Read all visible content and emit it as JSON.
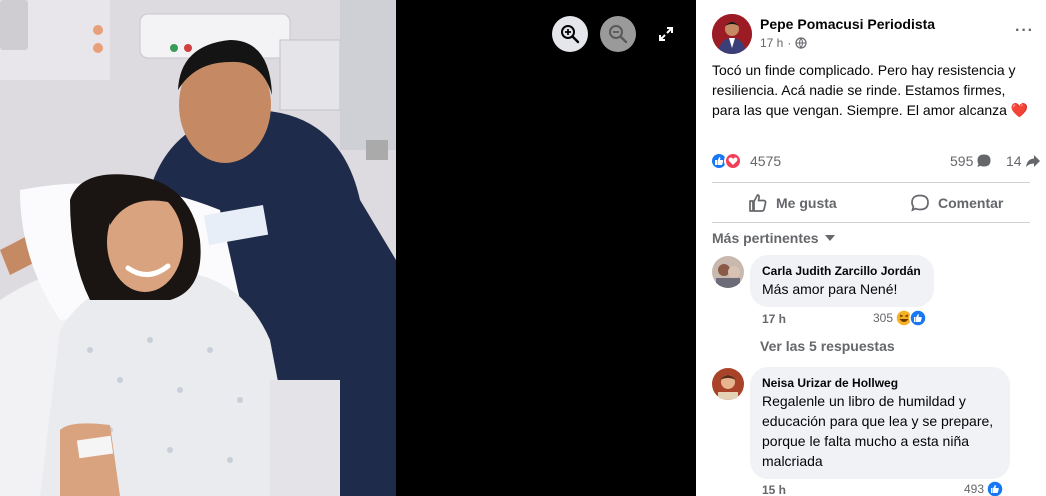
{
  "post": {
    "author": "Pepe Pomacusi Periodista",
    "time": "17 h",
    "privacy_icon": "globe-icon",
    "text": "Tocó un finde complicado. Pero hay resistencia y resiliencia. Acá nadie se rinde. Estamos firmes, para las que vengan. Siempre. El amor alcanza",
    "text_emoji": "❤️"
  },
  "stats": {
    "reactions": "4575",
    "comments": "595",
    "shares": "14"
  },
  "actions": {
    "like": "Me gusta",
    "comment": "Comentar"
  },
  "comments_sort": "Más pertinentes",
  "comments": [
    {
      "name": "Carla Judith Zarcillo Jordán",
      "body": "Más amor para Nené!",
      "time": "17 h",
      "reactions": "305"
    },
    {
      "name": "Neisa Urizar de Hollweg",
      "body": "Regalenle un libro de humildad y educación para que lea y se prepare, porque le falta mucho a esta niña malcriada",
      "time": "15 h",
      "reactions": "493"
    }
  ],
  "view_replies": "Ver las 5 respuestas",
  "colors": {
    "accent": "#1877f2",
    "love": "#f33e58",
    "text_secondary": "#65676b"
  }
}
